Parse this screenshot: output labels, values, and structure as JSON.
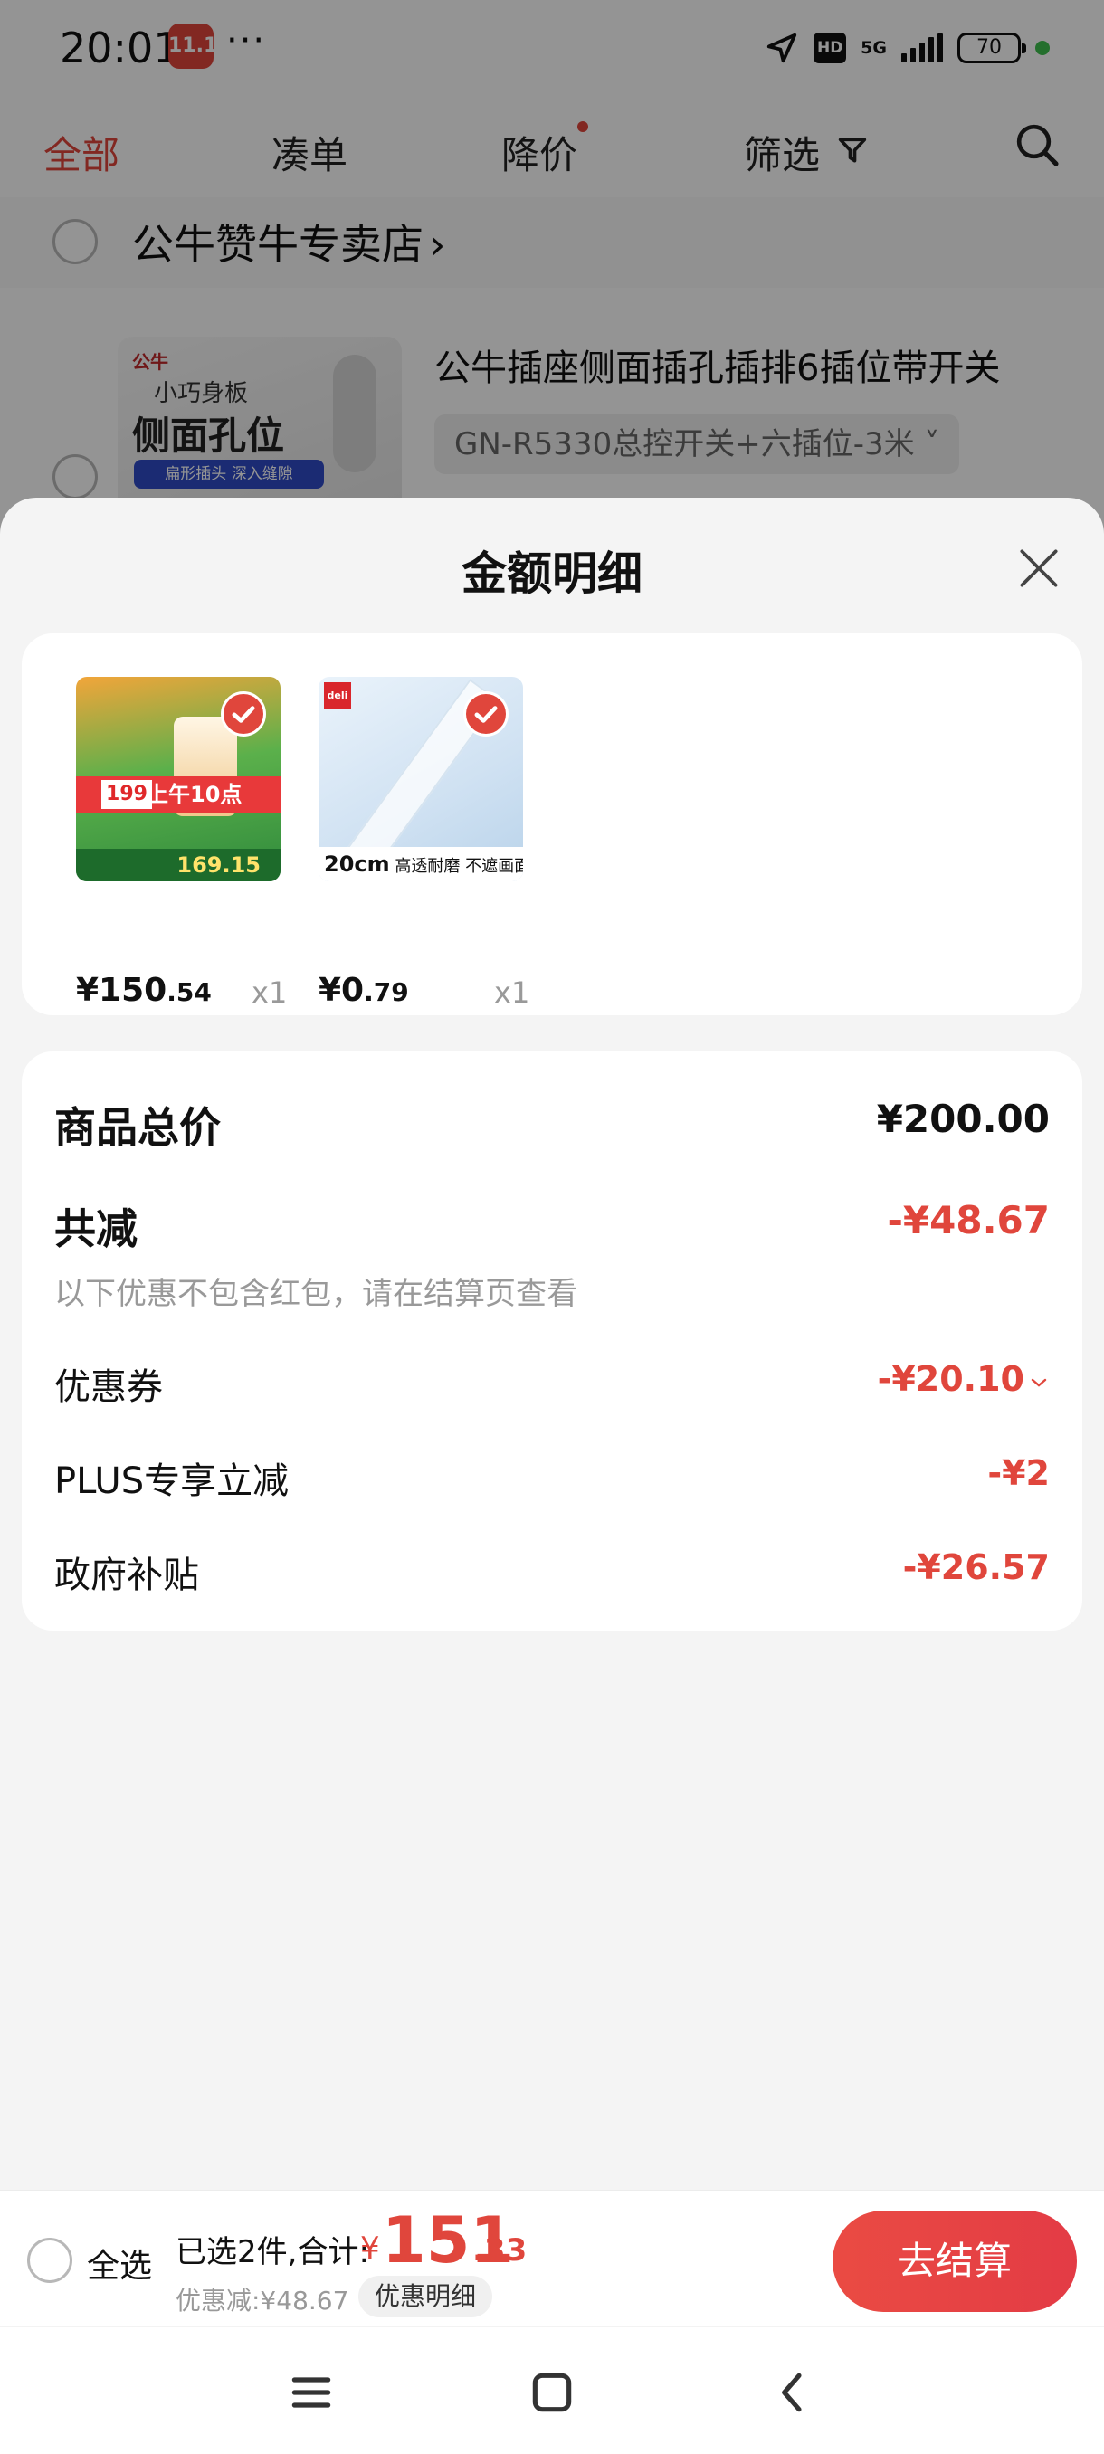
{
  "status_bar": {
    "time": "20:01",
    "app_icon_text": "11.11",
    "dots": "···",
    "hd_label": "HD",
    "network": "5G",
    "battery": "70",
    "colors": {
      "charge_dot": "#3fbf4f"
    }
  },
  "tabs": [
    {
      "label": "全部",
      "active": true
    },
    {
      "label": "凑单",
      "active": false
    },
    {
      "label": "降价",
      "active": false
    },
    {
      "label": "筛选",
      "active": false
    }
  ],
  "background_cart": {
    "store_name": "公牛赞牛专卖店",
    "store_arrow": "›",
    "product": {
      "title": "公牛插座侧面插孔插排6插位带开关",
      "spec": "GN-R5330总控开关+六插位-3米 ˅",
      "thumb_brand": "公牛",
      "thumb_small": "小巧身板",
      "thumb_big": "侧面孔位",
      "thumb_tagline": "扁形插头 深入缝隙"
    }
  },
  "sheet": {
    "title": "金额明细",
    "items": [
      {
        "price_int": "¥150",
        "price_dec": ".54",
        "qty": "x1",
        "img_banner": "上午10点",
        "img_tag": "199",
        "img_price": "169.15"
      },
      {
        "price_int": "¥0",
        "price_dec": ".79",
        "qty": "x1",
        "img_logo": "deli",
        "img_size": "20cm",
        "img_caption": "高透耐磨 不遮画面"
      }
    ],
    "summary": {
      "total_label": "商品总价",
      "total_value": "¥200.00",
      "reduce_label": "共减",
      "reduce_value": "-¥48.67",
      "note": "以下优惠不包含红包，请在结算页查看",
      "coupon_label": "优惠券",
      "coupon_value": "-¥20.10",
      "plus_label": "PLUS专享立减",
      "plus_value": "-¥2",
      "gov_label": "政府补贴",
      "gov_value": "-¥26.57"
    }
  },
  "checkout": {
    "select_all": "全选",
    "selected_text": "已选2件,合计:",
    "total_yen": "¥",
    "total_int": "151",
    "total_dec": ".33",
    "discount_text": "优惠减:¥48.67",
    "detail_chip": "优惠明细",
    "button": "去结算",
    "colors": {
      "accent": "#e0463c"
    }
  },
  "icons": [
    "filter-icon",
    "search-icon",
    "close-icon",
    "check-icon",
    "chevron-down-icon",
    "menu-icon",
    "home-icon",
    "back-icon"
  ]
}
